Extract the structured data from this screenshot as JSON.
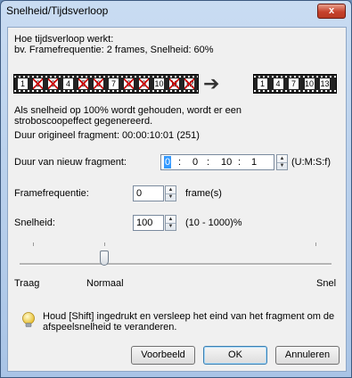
{
  "window": {
    "title": "Snelheid/Tijdsverloop",
    "close_label": "x"
  },
  "intro": {
    "line1": "Hoe tijdsverloop werkt:",
    "line2": "bv. Framefrequentie: 2 frames, Snelheid: 60%"
  },
  "strip_original": {
    "frames": [
      {
        "label": "1",
        "dropped": false
      },
      {
        "label": "2",
        "dropped": true
      },
      {
        "label": "3",
        "dropped": true
      },
      {
        "label": "4",
        "dropped": false
      },
      {
        "label": "5",
        "dropped": true
      },
      {
        "label": "6",
        "dropped": true
      },
      {
        "label": "7",
        "dropped": false
      },
      {
        "label": "8",
        "dropped": true
      },
      {
        "label": "9",
        "dropped": true
      },
      {
        "label": "10",
        "dropped": false
      },
      {
        "label": "11",
        "dropped": true
      },
      {
        "label": "12",
        "dropped": true
      }
    ]
  },
  "strip_result": {
    "frames": [
      "1",
      "4",
      "7",
      "10",
      "13"
    ]
  },
  "info": {
    "line1": "Als snelheid op 100% wordt gehouden, wordt er een",
    "line2": "stroboscoopeffect gegenereerd.",
    "original_duration": "Duur origineel fragment: 00:00:10:01 (251)"
  },
  "duration": {
    "label": "Duur van nieuw fragment:",
    "hours": "0",
    "minutes": "0",
    "seconds": "10",
    "frames": "1",
    "unit": "(U:M:S:f)"
  },
  "framerate": {
    "label": "Framefrequentie:",
    "value": "0",
    "unit": "frame(s)"
  },
  "speed": {
    "label": "Snelheid:",
    "value": "100",
    "range": "(10 - 1000)%"
  },
  "slider": {
    "value_percent": 100,
    "min_label": "Traag",
    "mid_label": "Normaal",
    "max_label": "Snel"
  },
  "tip": {
    "line1": "Houd [Shift] ingedrukt en versleep het eind van het fragment om de",
    "line2": "afspeelsnelheid te veranderen."
  },
  "buttons": {
    "preview": "Voorbeeld",
    "ok": "OK",
    "cancel": "Annuleren"
  },
  "colors": {
    "accent": "#3c7fb1",
    "dropped": "#cc0000"
  }
}
